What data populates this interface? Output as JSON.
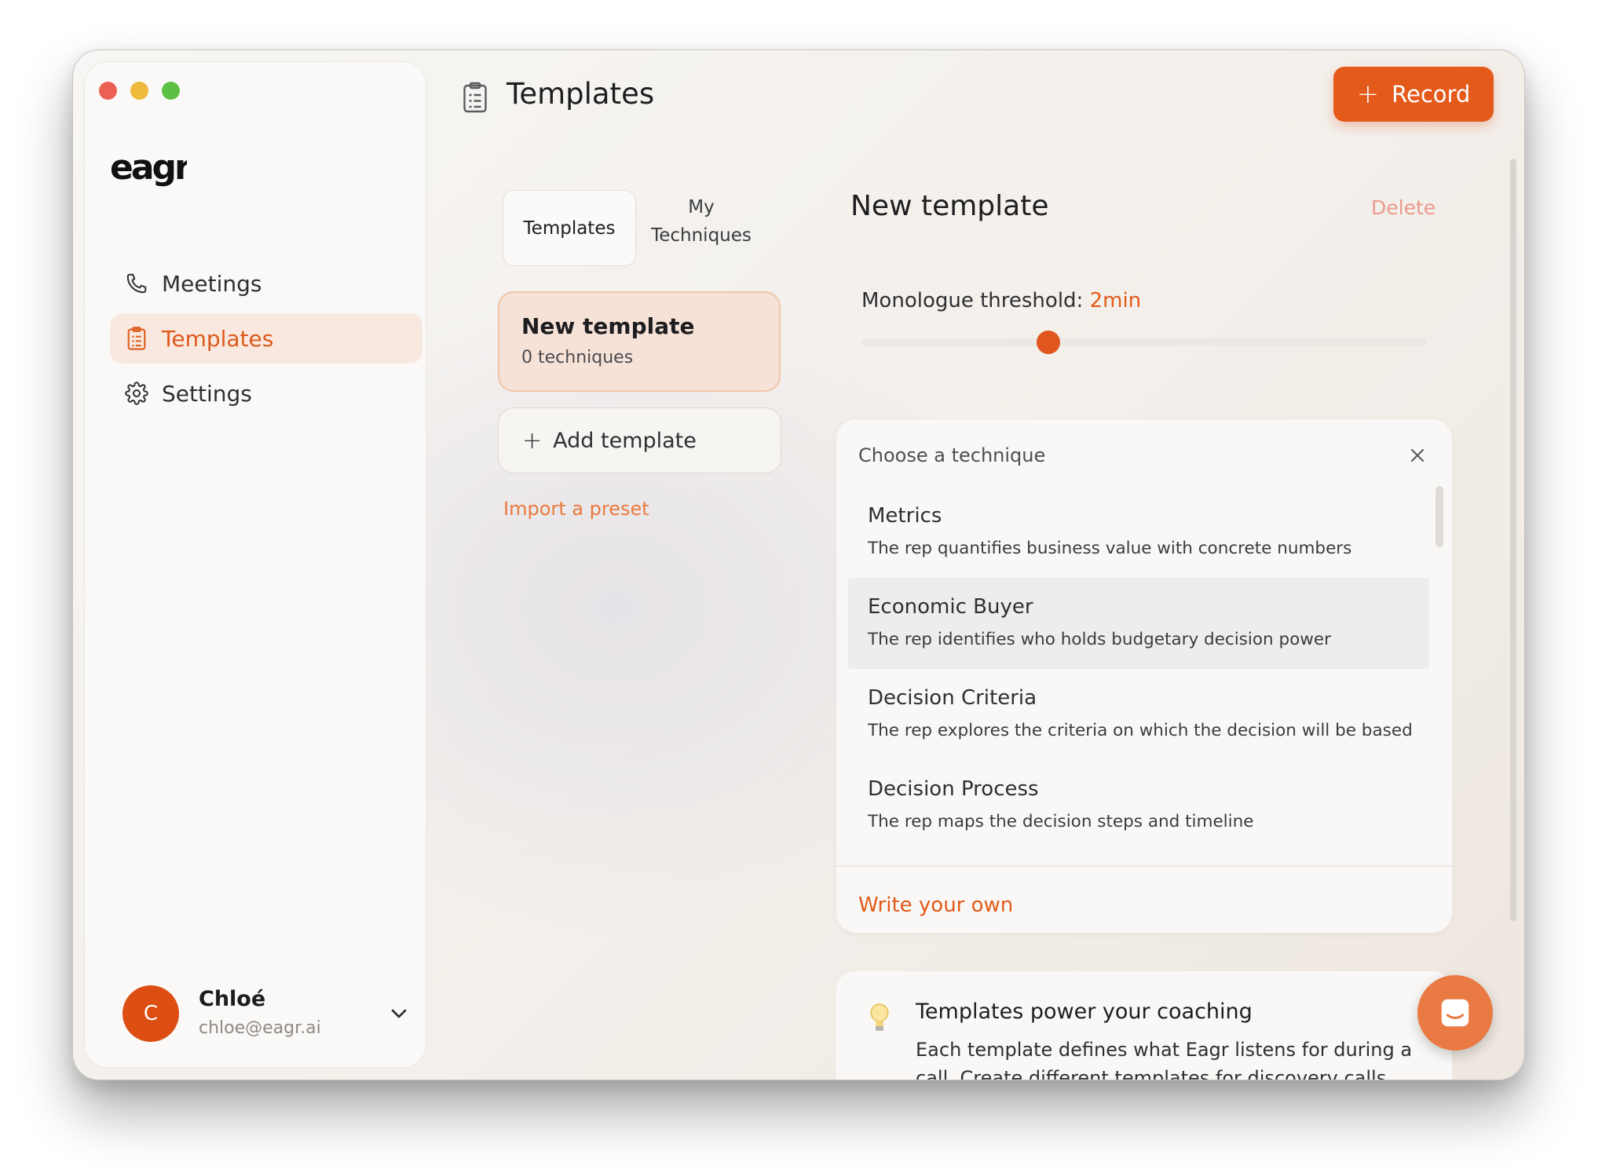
{
  "app": {
    "logo_text": "eagr."
  },
  "sidebar": {
    "items": [
      {
        "label": "Meetings",
        "icon": "phone-icon",
        "active": false
      },
      {
        "label": "Templates",
        "icon": "clipboard-icon",
        "active": true
      },
      {
        "label": "Settings",
        "icon": "gear-icon",
        "active": false
      }
    ],
    "user": {
      "initial": "C",
      "name": "Chloé",
      "email": "chloe@eagr.ai"
    }
  },
  "header": {
    "title": "Templates",
    "record_label": "Record"
  },
  "tabs": [
    {
      "label": "Templates",
      "active": true
    },
    {
      "label": "My Techniques",
      "active": false
    }
  ],
  "templates": [
    {
      "name": "New template",
      "subtitle": "0 techniques"
    }
  ],
  "actions": {
    "add_template": "Add template",
    "import_preset": "Import a preset"
  },
  "detail": {
    "title": "New template",
    "delete_label": "Delete",
    "monologue_label": "Monologue threshold:",
    "monologue_value": "2min",
    "slider_fraction": 0.33
  },
  "technique_picker": {
    "heading": "Choose a technique",
    "items": [
      {
        "name": "Metrics",
        "description": "The rep quantifies business value with concrete numbers"
      },
      {
        "name": "Economic Buyer",
        "description": "The rep identifies who holds budgetary decision power"
      },
      {
        "name": "Decision Criteria",
        "description": "The rep explores the criteria on which the decision will be based"
      },
      {
        "name": "Decision Process",
        "description": "The rep maps the decision steps and timeline"
      }
    ],
    "write_own": "Write your own"
  },
  "info": {
    "title": "Templates power your coaching",
    "body": "Each template defines what Eagr listens for during a call. Create different templates for discovery calls, demos"
  },
  "colors": {
    "accent": "#e25a18",
    "accent_light": "#f9e8df",
    "delete": "#eb9a8e"
  }
}
